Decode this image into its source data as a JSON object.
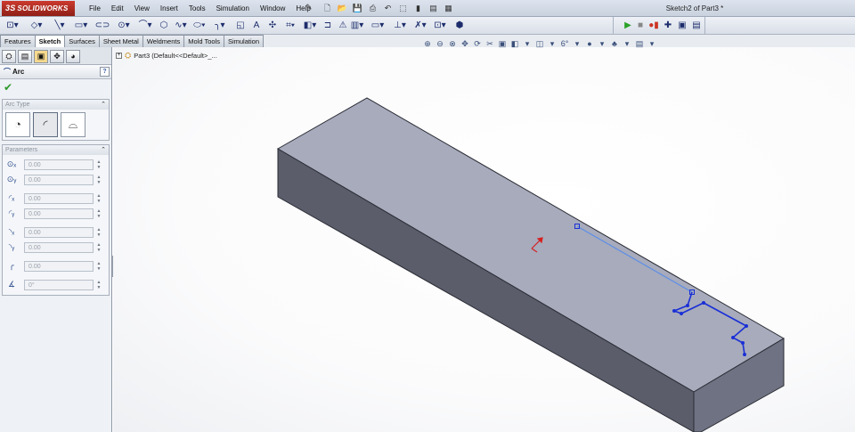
{
  "app": {
    "brand": "SOLIDWORKS",
    "brand_prefix": "3S",
    "document_title": "Sketch2 of Part3 *"
  },
  "menu": [
    "File",
    "Edit",
    "View",
    "Insert",
    "Tools",
    "Simulation",
    "Window",
    "Help"
  ],
  "tabs": [
    {
      "label": "Features",
      "active": false
    },
    {
      "label": "Sketch",
      "active": true
    },
    {
      "label": "Surfaces",
      "active": false
    },
    {
      "label": "Sheet Metal",
      "active": false
    },
    {
      "label": "Weldments",
      "active": false
    },
    {
      "label": "Mold Tools",
      "active": false
    },
    {
      "label": "Simulation",
      "active": false
    }
  ],
  "property_manager": {
    "title": "Arc",
    "help": "?",
    "ok_symbol": "✔",
    "arc_type_label": "Arc Type",
    "parameters_label": "Parameters",
    "fields": [
      {
        "icon": "center-x-icon",
        "value": "0.00"
      },
      {
        "icon": "center-y-icon",
        "value": "0.00"
      },
      {
        "icon": "start-x-icon",
        "value": "0.00"
      },
      {
        "icon": "start-y-icon",
        "value": "0.00"
      },
      {
        "icon": "end-x-icon",
        "value": "0.00"
      },
      {
        "icon": "end-y-icon",
        "value": "0.00"
      },
      {
        "icon": "radius-icon",
        "value": "0.00"
      },
      {
        "icon": "angle-icon",
        "value": "0°"
      }
    ]
  },
  "feature_tree": {
    "item": "Part3  (Default<<Default>_..."
  },
  "colors": {
    "sketch": "#1a2fd6",
    "origin": "#d62020",
    "block_top": "#a7abbc",
    "block_front": "#5a5c6a",
    "block_end": "#6f7282"
  }
}
